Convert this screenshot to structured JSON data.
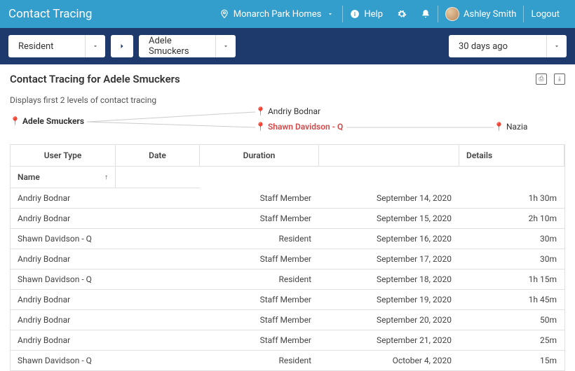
{
  "header": {
    "title": "Contact Tracing",
    "location": "Monarch Park Homes",
    "help": "Help",
    "user": "Ashley Smith",
    "logout": "Logout"
  },
  "filter": {
    "type": "Resident",
    "person": "Adele Smuckers",
    "range": "30 days ago"
  },
  "subheader": {
    "title": "Contact Tracing for Adele Smuckers"
  },
  "caption": "Displays first 2 levels of contact tracing",
  "graph": {
    "root": "Adele Smuckers",
    "n1": "Andriy Bodnar",
    "n2": "Shawn Davidson - Q",
    "n3": "Nazia"
  },
  "table": {
    "headers": {
      "name": "Name",
      "details": "Details",
      "user_type": "User Type",
      "date": "Date",
      "duration": "Duration"
    },
    "rows": [
      {
        "name": "Andriy Bodnar",
        "user_type": "Staff Member",
        "date": "September 14, 2020",
        "duration": "1h 30m"
      },
      {
        "name": "Andriy Bodnar",
        "user_type": "Staff Member",
        "date": "September 15, 2020",
        "duration": "2h 10m"
      },
      {
        "name": "Shawn Davidson - Q",
        "user_type": "Resident",
        "date": "September 16, 2020",
        "duration": "30m"
      },
      {
        "name": "Andriy Bodnar",
        "user_type": "Staff Member",
        "date": "September 17, 2020",
        "duration": "30m"
      },
      {
        "name": "Shawn Davidson - Q",
        "user_type": "Resident",
        "date": "September 18, 2020",
        "duration": "1h 15m"
      },
      {
        "name": "Andriy Bodnar",
        "user_type": "Staff Member",
        "date": "September 19, 2020",
        "duration": "1h 45m"
      },
      {
        "name": "Andriy Bodnar",
        "user_type": "Staff Member",
        "date": "September 20, 2020",
        "duration": "50m"
      },
      {
        "name": "Andriy Bodnar",
        "user_type": "Staff Member",
        "date": "September 21, 2020",
        "duration": "25m"
      },
      {
        "name": "Shawn Davidson - Q",
        "user_type": "Resident",
        "date": "October 4, 2020",
        "duration": "15m"
      }
    ]
  }
}
